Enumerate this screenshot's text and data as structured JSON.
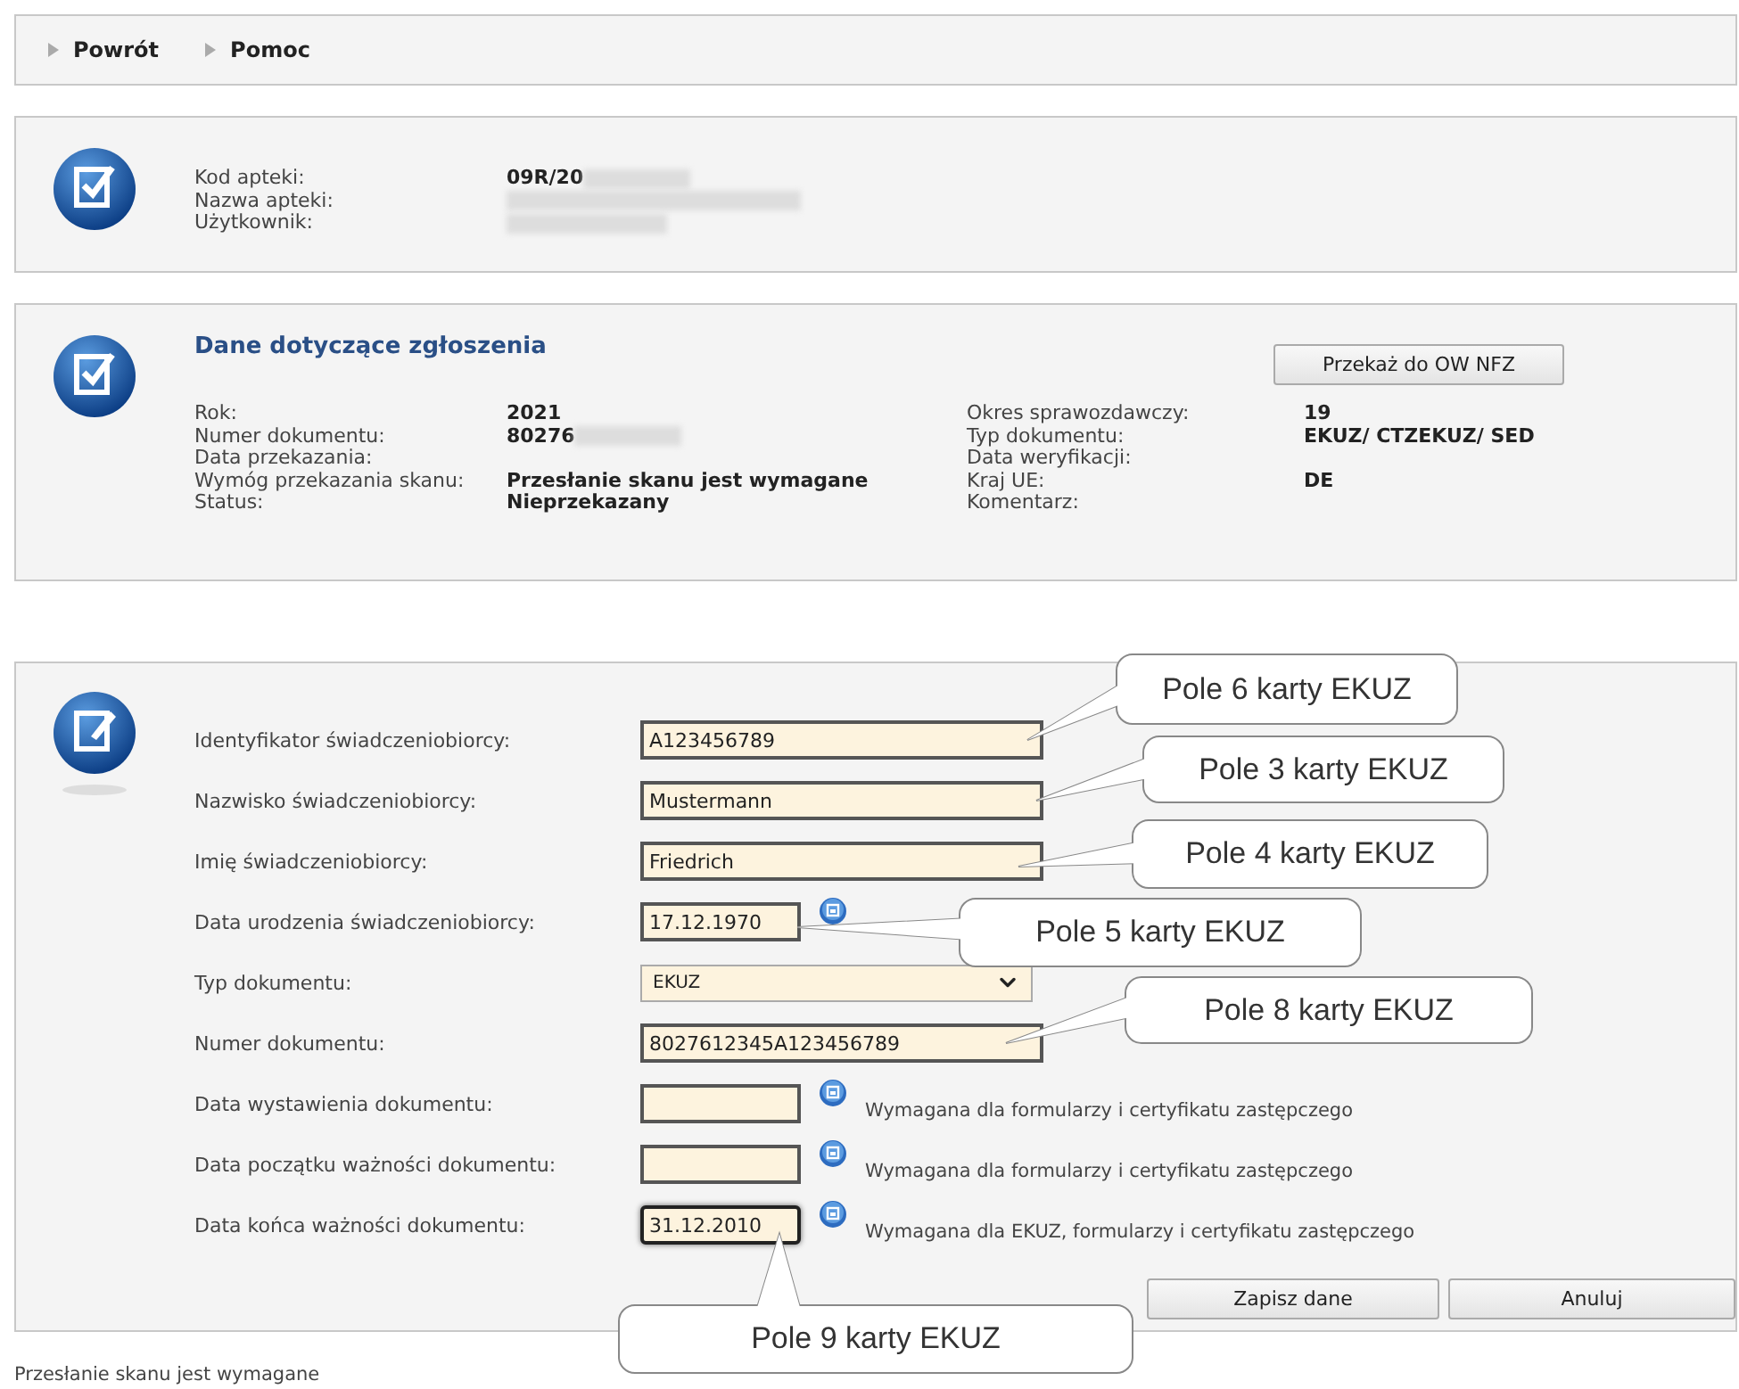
{
  "nav": [
    {
      "label": "Powrót"
    },
    {
      "label": "Pomoc"
    }
  ],
  "pharmacy": {
    "rows": [
      {
        "label": "Kod apteki:",
        "value": "09R/20",
        "redacted": true
      },
      {
        "label": "Nazwa apteki:",
        "redacted": true
      },
      {
        "label": "Użytkownik:",
        "redacted": true
      }
    ]
  },
  "report": {
    "title": "Dane dotyczące zgłoszenia",
    "button": "Przekaż do OW NFZ",
    "left": [
      {
        "label": "Rok:",
        "value": "2021"
      },
      {
        "label": "Numer dokumentu:",
        "value": "80276",
        "redacted": true
      },
      {
        "label": "Data przekazania:"
      },
      {
        "label": "Wymóg przekazania skanu:",
        "value": "Przesłanie skanu jest wymagane"
      },
      {
        "label": "Status:",
        "value": "Nieprzekazany"
      }
    ],
    "right": [
      {
        "label": "Okres sprawozdawczy:",
        "value": "19"
      },
      {
        "label": "Typ dokumentu:",
        "value": "EKUZ/ CTZEKUZ/ SED"
      },
      {
        "label": "Data weryfikacji:"
      },
      {
        "label": "Kraj UE:",
        "value": "DE"
      },
      {
        "label": "Komentarz:"
      }
    ]
  },
  "form": {
    "fields": [
      {
        "label": "Identyfikator świadczeniobiorcy:",
        "kind": "text",
        "value": "A123456789",
        "focused": false
      },
      {
        "label": "Nazwisko świadczeniobiorcy:",
        "kind": "text",
        "value": "Mustermann",
        "focused": false
      },
      {
        "label": "Imię świadczeniobiorcy:",
        "kind": "text",
        "value": "Friedrich",
        "focused": false
      },
      {
        "label": "Data urodzenia świadczeniobiorcy:",
        "kind": "date",
        "value": "17.12.1970",
        "focused": false
      },
      {
        "label": "Typ dokumentu:",
        "kind": "select",
        "value": "EKUZ",
        "focused": false
      },
      {
        "label": "Numer dokumentu:",
        "kind": "text",
        "value": "8027612345A123456789",
        "focused": false
      },
      {
        "label": "Data wystawienia dokumentu:",
        "kind": "date",
        "hint": "Wymagana dla formularzy i certyfikatu zastępczego",
        "focused": false
      },
      {
        "label": "Data początku ważności dokumentu:",
        "kind": "date",
        "hint": "Wymagana dla formularzy i certyfikatu zastępczego",
        "focused": false
      },
      {
        "label": "Data końca ważności dokumentu:",
        "kind": "date",
        "value": "31.12.2010",
        "hint": "Wymagana dla EKUZ, formularzy i certyfikatu zastępczego",
        "focused": true
      }
    ],
    "buttons": [
      "Zapisz dane",
      "Anuluj"
    ],
    "callouts": [
      {
        "text": "Pole 6 karty EKUZ"
      },
      {
        "text": "Pole 3 karty EKUZ"
      },
      {
        "text": "Pole 4 karty EKUZ"
      },
      {
        "text": "Pole 5 karty EKUZ"
      },
      {
        "text": "Pole 8 karty EKUZ"
      },
      {
        "text": "Pole 9 karty EKUZ"
      }
    ]
  },
  "footer_note": "Przesłanie skanu jest wymagane"
}
